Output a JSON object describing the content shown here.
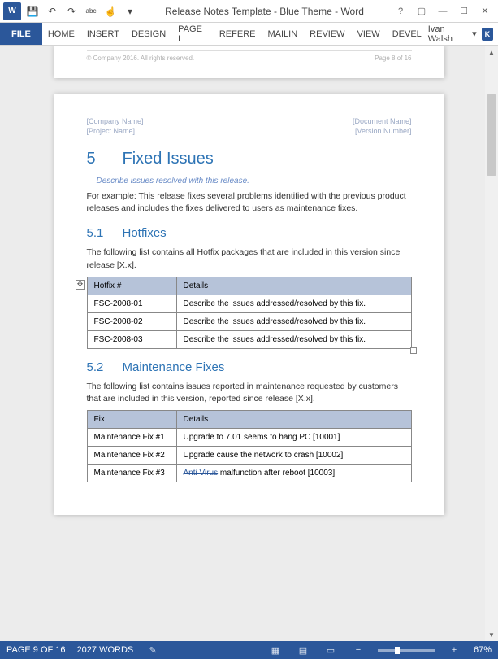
{
  "app": {
    "title": "Release Notes Template - Blue Theme - Word",
    "user": "Ivan Walsh",
    "user_initial": "K"
  },
  "qat": {
    "save": "💾",
    "undo": "↶",
    "redo": "↷",
    "spell": "abc",
    "touch": "☝"
  },
  "ribbon": {
    "file": "FILE",
    "tabs": [
      "HOME",
      "INSERT",
      "DESIGN",
      "PAGE L",
      "REFERE",
      "MAILIN",
      "REVIEW",
      "VIEW",
      "DEVEL"
    ]
  },
  "prev_page": {
    "copyright": "© Company 2016. All rights reserved.",
    "page_ref": "Page 8 of 16"
  },
  "doc": {
    "header": {
      "left1": "[Company Name]",
      "left2": "[Project Name]",
      "right1": "[Document Name]",
      "right2": "[Version Number]"
    },
    "h1_num": "5",
    "h1_text": "Fixed Issues",
    "instruction": "Describe issues resolved with this release.",
    "intro": "For example: This release fixes several problems identified with the previous product releases and includes the fixes delivered to users as maintenance fixes.",
    "h2a_num": "5.1",
    "h2a_text": "Hotfixes",
    "hotfix_intro": "The following list contains all Hotfix packages that are included in this version since release [X.x].",
    "hotfix_cols": {
      "c1": "Hotfix #",
      "c2": "Details"
    },
    "hotfix_rows": [
      {
        "id": "FSC-2008-01",
        "detail": "Describe the issues addressed/resolved by this fix."
      },
      {
        "id": "FSC-2008-02",
        "detail": "Describe the issues addressed/resolved by this fix."
      },
      {
        "id": "FSC-2008-03",
        "detail": "Describe the issues addressed/resolved by this fix."
      }
    ],
    "h2b_num": "5.2",
    "h2b_text": "Maintenance Fixes",
    "maint_intro": "The following list contains issues reported in maintenance requested by customers that are included in this version, reported since release [X.x].",
    "maint_cols": {
      "c1": "Fix",
      "c2": "Details"
    },
    "maint_rows": [
      {
        "id": "Maintenance Fix #1",
        "detail": "Upgrade to 7.01 seems to hang PC [10001]"
      },
      {
        "id": "Maintenance Fix #2",
        "detail": "Upgrade cause the network to crash [10002]"
      },
      {
        "id": "Maintenance Fix #3",
        "detail_prefix": "Anti Virus",
        "detail_rest": " malfunction after reboot [10003]"
      }
    ]
  },
  "status": {
    "page": "PAGE 9 OF 16",
    "words": "2027 WORDS",
    "zoom": "67%"
  }
}
